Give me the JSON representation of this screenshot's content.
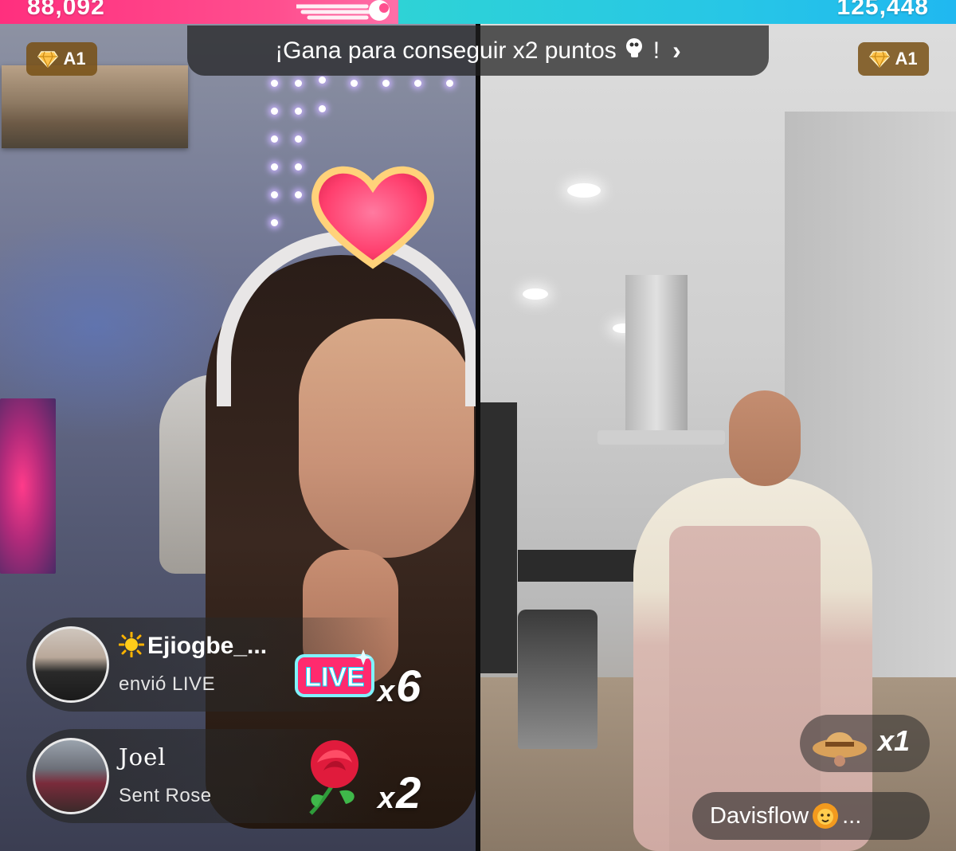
{
  "scores": {
    "left": "88,092",
    "right": "125,448"
  },
  "colors": {
    "left_team": "#ff3f88",
    "right_team": "#27c6e6",
    "badge": "#7a5014"
  },
  "rank_badges": {
    "left": "A1",
    "right": "A1",
    "icon": "diamond-icon"
  },
  "banner": {
    "text": "¡Gana para conseguir x2 puntos",
    "suffix": "!",
    "icon": "sparkle-icon",
    "chevron": "›"
  },
  "gifts": [
    {
      "user": "Ejiogbe_...",
      "user_icon": "sun-icon",
      "action": "envió LIVE",
      "gift": "LIVE",
      "count_prefix": "x",
      "count": "6"
    },
    {
      "user": "Joel",
      "action": "Sent Rose",
      "gift": "rose",
      "count_prefix": "x",
      "count": "2"
    }
  ],
  "right_gift": {
    "gift": "hat",
    "count": "x1"
  },
  "viewer": {
    "name": "Davisflow",
    "trailing": " ...",
    "icon": "lion-icon"
  }
}
